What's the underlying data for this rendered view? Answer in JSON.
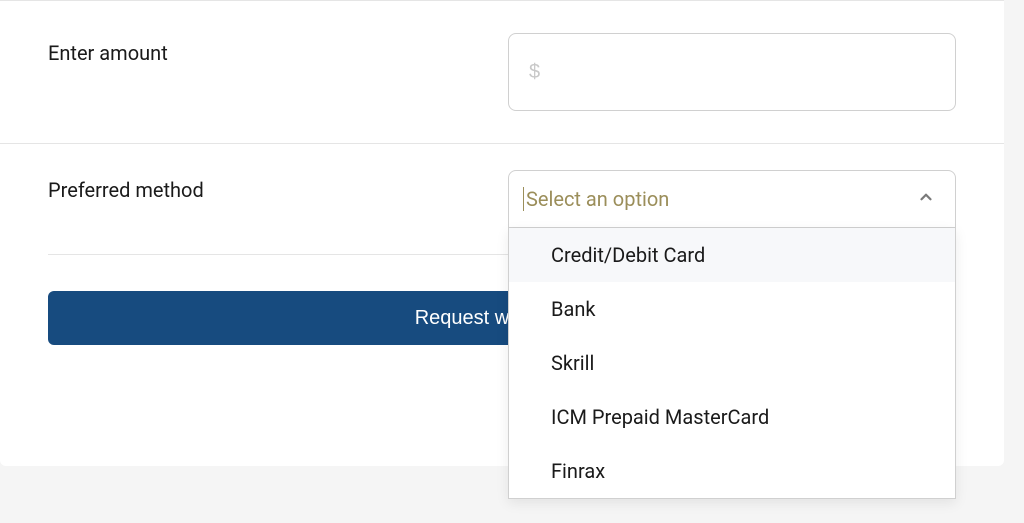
{
  "form": {
    "amount": {
      "label": "Enter amount",
      "placeholder": "$",
      "value": ""
    },
    "method": {
      "label": "Preferred method",
      "placeholder": "Select an option",
      "options": [
        "Credit/Debit Card",
        "Bank",
        "Skrill",
        "ICM Prepaid MasterCard",
        "Finrax"
      ]
    },
    "submit_label": "Request withdrawal"
  }
}
